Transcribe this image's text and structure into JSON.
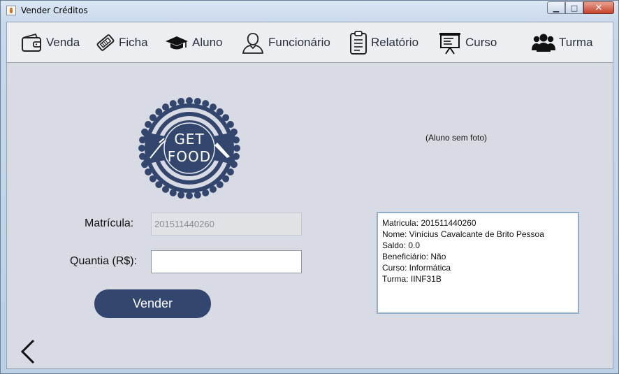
{
  "window": {
    "title": "Vender Créditos",
    "minimize": "▁",
    "maximize": "□",
    "close": "✕"
  },
  "menu": [
    {
      "label": "Venda",
      "icon": "wallet-icon"
    },
    {
      "label": "Ficha",
      "icon": "ticket-icon"
    },
    {
      "label": "Aluno",
      "icon": "graduation-cap-icon"
    },
    {
      "label": "Funcionário",
      "icon": "person-icon"
    },
    {
      "label": "Relatório",
      "icon": "clipboard-icon"
    },
    {
      "label": "Curso",
      "icon": "presentation-board-icon"
    },
    {
      "label": "Turma",
      "icon": "group-icon"
    }
  ],
  "logo": {
    "line1": "GET",
    "line2": "FOOD"
  },
  "photo": {
    "placeholder": "(Aluno sem foto)"
  },
  "form": {
    "matricula_label": "Matrícula:",
    "matricula_value": "201511440260",
    "quantia_label": "Quantia (R$):",
    "quantia_value": "",
    "submit_label": "Vender"
  },
  "info": {
    "matricula": "Matricula: 201511440260",
    "nome": "Nome: Vinícius Cavalcante de Brito Pessoa",
    "saldo": "Saldo: 0.0",
    "beneficiario": "Beneficiário: Não",
    "curso": "Curso: Informática",
    "turma": "Turma: IINF31B"
  },
  "colors": {
    "accent": "#33466e",
    "client_bg": "#d8dbe3",
    "menubar_bg": "#eceef2"
  }
}
